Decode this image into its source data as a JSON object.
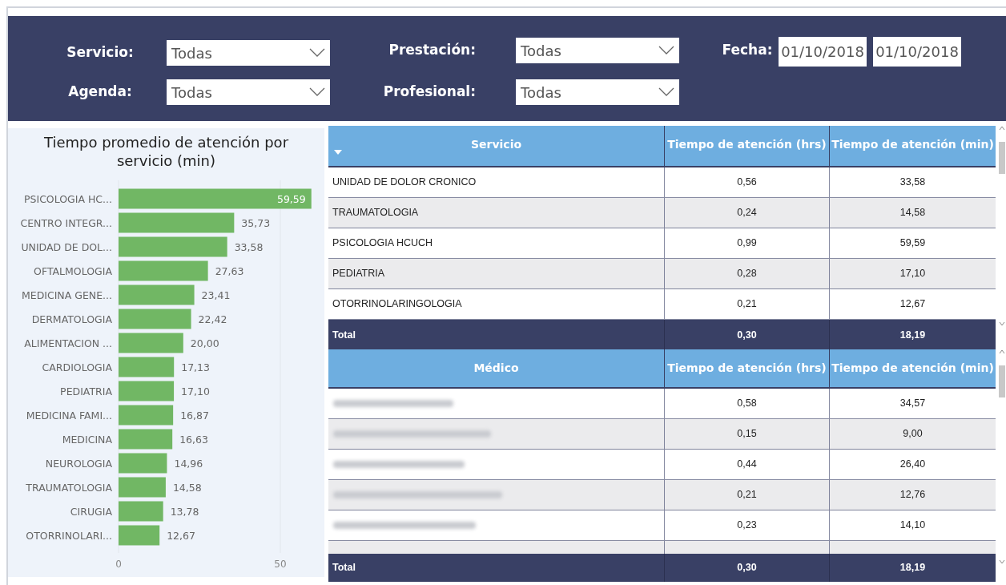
{
  "filters": [
    {
      "label": "Servicio:",
      "kind": "dropdown",
      "value": "Todas"
    },
    {
      "label": "Prestación:",
      "kind": "dropdown",
      "value": "Todas"
    },
    {
      "label": "Fecha:",
      "kind": "dates",
      "values": [
        "01/10/2018",
        "01/10/2018"
      ]
    },
    {
      "label": "Agenda:",
      "kind": "dropdown",
      "value": "Todas"
    },
    {
      "label": "Profesional:",
      "kind": "dropdown",
      "value": "Todas"
    }
  ],
  "chart": {
    "chart_data": {
      "type": "bar",
      "orientation": "horizontal",
      "title": "Tiempo promedio de atención por servicio (min)",
      "categories": [
        "PSICOLOGIA HC...",
        "CENTRO INTEGR...",
        "UNIDAD DE DOL...",
        "OFTALMOLOGIA",
        "MEDICINA GENE...",
        "DERMATOLOGIA",
        "ALIMENTACION ...",
        "CARDIOLOGIA",
        "PEDIATRIA",
        "MEDICINA FAMI...",
        "MEDICINA",
        "NEUROLOGIA",
        "TRAUMATOLOGIA",
        "CIRUGIA",
        "OTORRINOLARI..."
      ],
      "values": [
        59.59,
        35.73,
        33.58,
        27.63,
        23.41,
        22.42,
        20.0,
        17.13,
        17.1,
        16.87,
        16.63,
        14.96,
        14.58,
        13.78,
        12.67
      ],
      "value_labels": [
        "59,59",
        "35,73",
        "33,58",
        "27,63",
        "23,41",
        "22,42",
        "20,00",
        "17,13",
        "17,10",
        "16,87",
        "16,63",
        "14,96",
        "14,58",
        "13,78",
        "12,67"
      ],
      "xticks": [
        0,
        50
      ],
      "xlim": [
        0,
        60
      ]
    }
  },
  "tables": [
    {
      "columns": [
        {
          "label": "Servicio",
          "sorted": true
        },
        {
          "label": "Tiempo de atención (hrs)",
          "sorted": false
        },
        {
          "label": "Tiempo de atención (min)",
          "sorted": false
        }
      ],
      "rows": [
        {
          "cells": [
            "UNIDAD DE DOLOR CRONICO",
            "0,56",
            "33,58"
          ]
        },
        {
          "cells": [
            "TRAUMATOLOGIA",
            "0,24",
            "14,58"
          ]
        },
        {
          "cells": [
            "PSICOLOGIA HCUCH",
            "0,99",
            "59,59"
          ]
        },
        {
          "cells": [
            "PEDIATRIA",
            "0,28",
            "17,10"
          ]
        },
        {
          "cells": [
            "OTORRINOLARINGOLOGIA",
            "0,21",
            "12,67"
          ]
        }
      ],
      "total": [
        "Total",
        "0,30",
        "18,19"
      ]
    },
    {
      "columns": [
        {
          "label": "Médico",
          "sorted": false
        },
        {
          "label": "Tiempo de atención (hrs)",
          "sorted": false
        },
        {
          "label": "Tiempo de atención (min)",
          "sorted": false
        }
      ],
      "rows": [
        {
          "cells": [
            "",
            "0,58",
            "34,57"
          ],
          "name_blurred": true
        },
        {
          "cells": [
            "",
            "0,15",
            "9,00"
          ],
          "name_blurred": true
        },
        {
          "cells": [
            "",
            "0,44",
            "26,40"
          ],
          "name_blurred": true
        },
        {
          "cells": [
            "",
            "0,21",
            "12,76"
          ],
          "name_blurred": true
        },
        {
          "cells": [
            "",
            "0,23",
            "14,10"
          ],
          "name_blurred": true
        }
      ],
      "total": [
        "Total",
        "0,30",
        "18,19"
      ]
    }
  ]
}
